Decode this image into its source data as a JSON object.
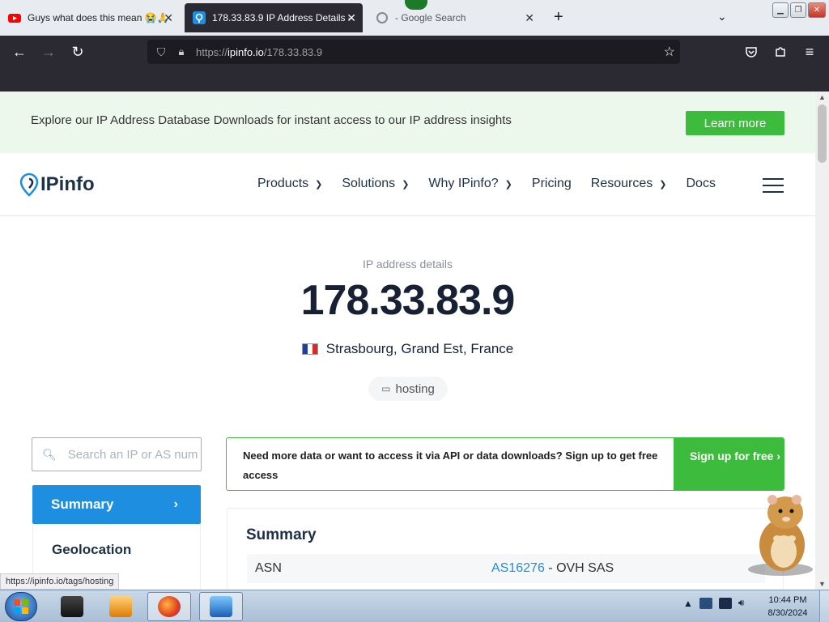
{
  "browser": {
    "tabs": [
      {
        "title": "Guys what does this mean 😭🙏",
        "favicon": "youtube-icon"
      },
      {
        "title": "178.33.83.9 IP Address Details -",
        "favicon": "ipinfo-icon"
      },
      {
        "title": "- Google Search",
        "favicon": "google-icon"
      }
    ],
    "url": {
      "protocol": "https://",
      "host": "ipinfo.io",
      "path": "/178.33.83.9"
    },
    "status_url": "https://ipinfo.io/tags/hosting"
  },
  "page": {
    "banner": {
      "text": "Explore our IP Address Database Downloads for instant access to our IP address insights",
      "button": "Learn more"
    },
    "logo": "IPinfo",
    "nav": [
      "Products",
      "Solutions",
      "Why IPinfo?",
      "Pricing",
      "Resources",
      "Docs"
    ],
    "hero": {
      "label": "IP address details",
      "ip": "178.33.83.9",
      "location": "Strasbourg, Grand Est, France",
      "tag": "hosting"
    },
    "search": {
      "placeholder": "Search an IP or AS number"
    },
    "sidebar": {
      "active": "Summary",
      "items": [
        "Geolocation"
      ]
    },
    "promo": {
      "text": "Need more data or want to access it via API or data downloads? Sign up to get free access",
      "cta": "Sign up for free ›"
    },
    "summary": {
      "title": "Summary",
      "rows": [
        {
          "key": "ASN",
          "asn_link": "AS16276",
          "value": " - OVH SAS"
        }
      ]
    }
  },
  "taskbar": {
    "time": "10:44 PM",
    "date": "8/30/2024"
  },
  "colors": {
    "accent_green": "#3dbb3d",
    "accent_blue": "#1e8fe0",
    "brand_navy": "#1e3047"
  }
}
